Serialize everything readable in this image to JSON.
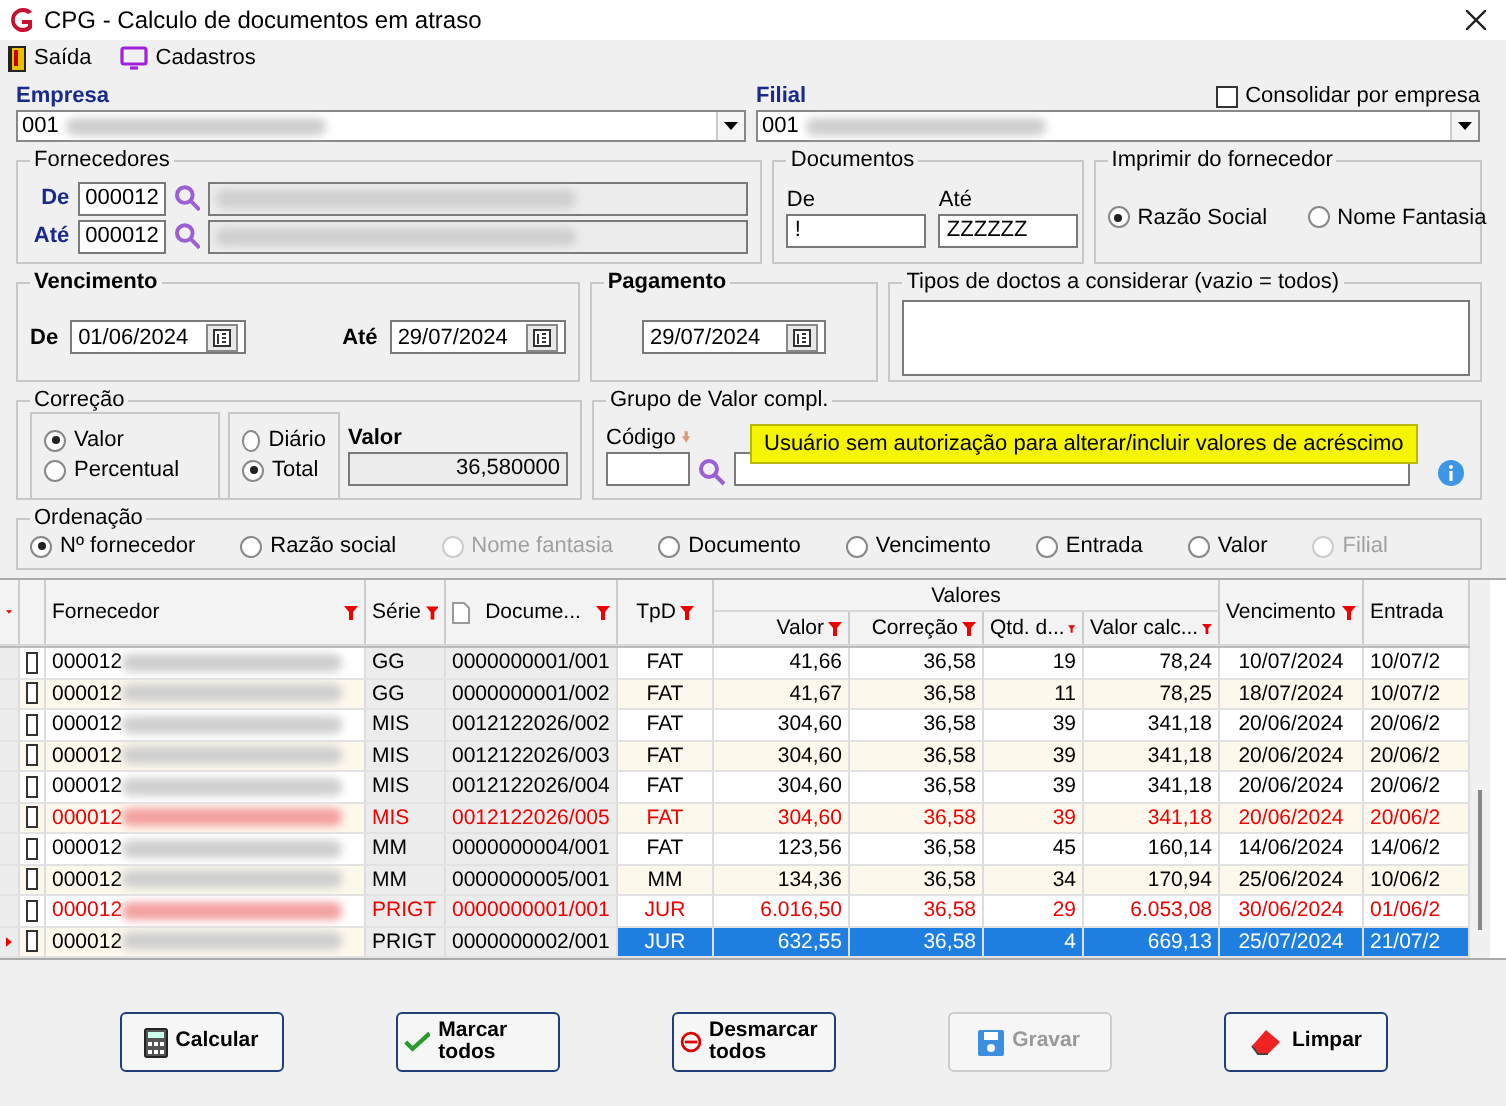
{
  "window": {
    "title": "CPG - Calculo de documentos em atraso"
  },
  "menu": [
    {
      "label": "Saída",
      "kind": "exit"
    },
    {
      "label": "Cadastros",
      "kind": "screen"
    }
  ],
  "empresa": {
    "label": "Empresa",
    "value": "001"
  },
  "filial": {
    "label": "Filial",
    "value": "001"
  },
  "consolidar": {
    "label": "Consolidar por empresa",
    "checked": false
  },
  "fornecedores": {
    "title": "Fornecedores",
    "from": {
      "label": "De",
      "value": "000012"
    },
    "to": {
      "label": "Até",
      "value": "000012"
    }
  },
  "documentos": {
    "title": "Documentos",
    "from": {
      "label": "De",
      "value": "!"
    },
    "to": {
      "label": "Até",
      "value": "ZZZZZZ"
    }
  },
  "imprimir": {
    "title": "Imprimir do fornecedor",
    "options": [
      {
        "label": "Razão Social",
        "selected": true
      },
      {
        "label": "Nome Fantasia",
        "selected": false
      }
    ]
  },
  "vencimento": {
    "title": "Vencimento",
    "from": {
      "label": "De",
      "value": "01/06/2024"
    },
    "to": {
      "label": "Até",
      "value": "29/07/2024"
    }
  },
  "pagamento": {
    "title": "Pagamento",
    "value": "29/07/2024"
  },
  "tipos": {
    "title": "Tipos de doctos a considerar (vazio = todos)"
  },
  "correcao": {
    "title": "Correção",
    "tipo": [
      {
        "label": "Valor",
        "selected": true
      },
      {
        "label": "Percentual",
        "selected": false
      }
    ],
    "modo": [
      {
        "label": "Diário",
        "selected": false
      },
      {
        "label": "Total",
        "selected": true
      }
    ],
    "valor_label": "Valor",
    "valor": "36,580000"
  },
  "grupo": {
    "title": "Grupo de Valor compl.",
    "codigo_label": "Código",
    "tooltip": "Usuário sem autorização para alterar/incluir valores de acréscimo"
  },
  "ordenacao": {
    "title": "Ordenação",
    "options": [
      {
        "label": "Nº fornecedor",
        "selected": true,
        "disabled": false
      },
      {
        "label": "Razão social",
        "selected": false,
        "disabled": false
      },
      {
        "label": "Nome fantasia",
        "selected": false,
        "disabled": true
      },
      {
        "label": "Documento",
        "selected": false,
        "disabled": false
      },
      {
        "label": "Vencimento",
        "selected": false,
        "disabled": false
      },
      {
        "label": "Entrada",
        "selected": false,
        "disabled": false
      },
      {
        "label": "Valor",
        "selected": false,
        "disabled": false
      },
      {
        "label": "Filial",
        "selected": false,
        "disabled": true
      }
    ]
  },
  "grid": {
    "group_header": "Valores",
    "columns": [
      "Fornecedor",
      "Série",
      "Docume...",
      "TpD",
      "Valor",
      "Correção",
      "Qtd. d...",
      "Valor calc...",
      "Vencimento",
      "Entrada"
    ],
    "rows": [
      {
        "fornecedor": "000012",
        "serie": "GG",
        "documento": "0000000001/001",
        "tpd": "FAT",
        "valor": "41,66",
        "correcao": "36,58",
        "qtd": "19",
        "valor_calc": "78,24",
        "vencimento": "10/07/2024",
        "entrada": "10/07/2",
        "checked": false,
        "overdue": false,
        "selected": false
      },
      {
        "fornecedor": "000012",
        "serie": "GG",
        "documento": "0000000001/002",
        "tpd": "FAT",
        "valor": "41,67",
        "correcao": "36,58",
        "qtd": "11",
        "valor_calc": "78,25",
        "vencimento": "18/07/2024",
        "entrada": "10/07/2",
        "checked": false,
        "overdue": false,
        "selected": false
      },
      {
        "fornecedor": "000012",
        "serie": "MIS",
        "documento": "0012122026/002",
        "tpd": "FAT",
        "valor": "304,60",
        "correcao": "36,58",
        "qtd": "39",
        "valor_calc": "341,18",
        "vencimento": "20/06/2024",
        "entrada": "20/06/2",
        "checked": false,
        "overdue": false,
        "selected": false
      },
      {
        "fornecedor": "000012",
        "serie": "MIS",
        "documento": "0012122026/003",
        "tpd": "FAT",
        "valor": "304,60",
        "correcao": "36,58",
        "qtd": "39",
        "valor_calc": "341,18",
        "vencimento": "20/06/2024",
        "entrada": "20/06/2",
        "checked": false,
        "overdue": false,
        "selected": false
      },
      {
        "fornecedor": "000012",
        "serie": "MIS",
        "documento": "0012122026/004",
        "tpd": "FAT",
        "valor": "304,60",
        "correcao": "36,58",
        "qtd": "39",
        "valor_calc": "341,18",
        "vencimento": "20/06/2024",
        "entrada": "20/06/2",
        "checked": false,
        "overdue": false,
        "selected": false
      },
      {
        "fornecedor": "000012",
        "serie": "MIS",
        "documento": "0012122026/005",
        "tpd": "FAT",
        "valor": "304,60",
        "correcao": "36,58",
        "qtd": "39",
        "valor_calc": "341,18",
        "vencimento": "20/06/2024",
        "entrada": "20/06/2",
        "checked": false,
        "overdue": true,
        "selected": false
      },
      {
        "fornecedor": "000012",
        "serie": "MM",
        "documento": "0000000004/001",
        "tpd": "FAT",
        "valor": "123,56",
        "correcao": "36,58",
        "qtd": "45",
        "valor_calc": "160,14",
        "vencimento": "14/06/2024",
        "entrada": "14/06/2",
        "checked": false,
        "overdue": false,
        "selected": false
      },
      {
        "fornecedor": "000012",
        "serie": "MM",
        "documento": "0000000005/001",
        "tpd": "MM",
        "valor": "134,36",
        "correcao": "36,58",
        "qtd": "34",
        "valor_calc": "170,94",
        "vencimento": "25/06/2024",
        "entrada": "10/06/2",
        "checked": false,
        "overdue": false,
        "selected": false
      },
      {
        "fornecedor": "000012",
        "serie": "PRIGT",
        "documento": "0000000001/001",
        "tpd": "JUR",
        "valor": "6.016,50",
        "correcao": "36,58",
        "qtd": "29",
        "valor_calc": "6.053,08",
        "vencimento": "30/06/2024",
        "entrada": "01/06/2",
        "checked": false,
        "overdue": true,
        "selected": false
      },
      {
        "fornecedor": "000012",
        "serie": "PRIGT",
        "documento": "0000000002/001",
        "tpd": "JUR",
        "valor": "632,55",
        "correcao": "36,58",
        "qtd": "4",
        "valor_calc": "669,13",
        "vencimento": "25/07/2024",
        "entrada": "21/07/2",
        "checked": false,
        "overdue": false,
        "selected": true
      }
    ]
  },
  "buttons": [
    {
      "label": "Calcular",
      "kind": "calc",
      "disabled": false
    },
    {
      "label": "Marcar todos",
      "kind": "check",
      "disabled": false
    },
    {
      "label": "Desmarcar todos",
      "kind": "uncheck",
      "disabled": false
    },
    {
      "label": "Gravar",
      "kind": "save",
      "disabled": true
    },
    {
      "label": "Limpar",
      "kind": "erase",
      "disabled": false
    }
  ]
}
